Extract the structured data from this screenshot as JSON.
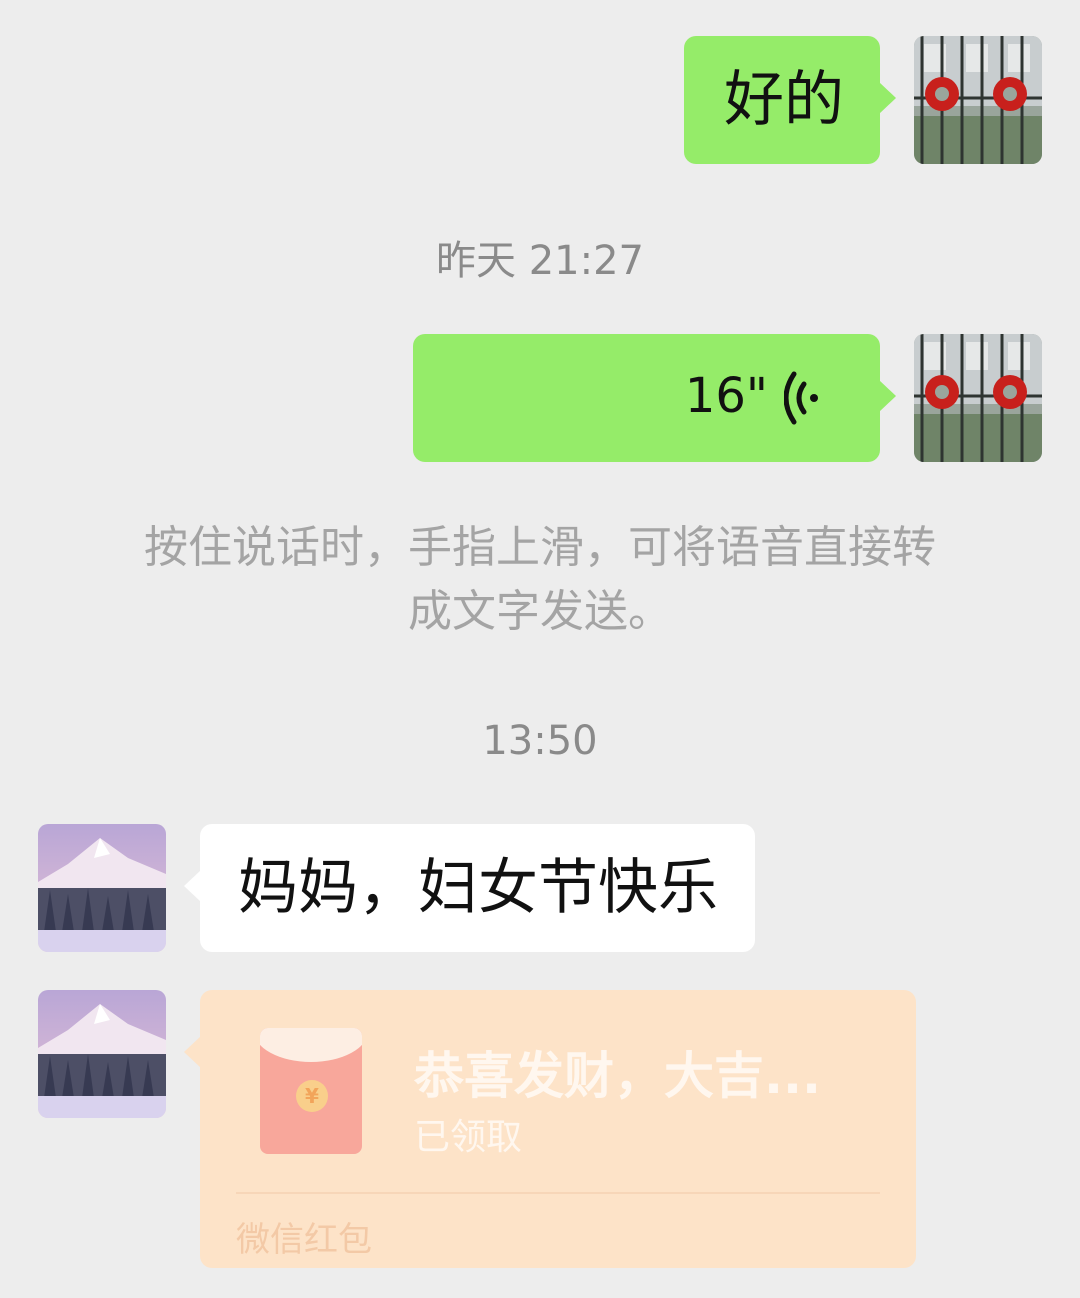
{
  "messages": {
    "msg1": {
      "text": "好的"
    },
    "voice": {
      "duration": "16\""
    },
    "msg3": {
      "text": "妈妈，妇女节快乐"
    },
    "red_packet": {
      "title": "恭喜发财，大吉...",
      "status": "已领取",
      "footer": "微信红包",
      "coin_symbol": "¥"
    }
  },
  "timestamps": {
    "t1": "昨天 21:27",
    "t2": "13:50"
  },
  "tip": {
    "line1": "按住说话时，手指上滑，可将语音直接转",
    "line2": "成文字发送。"
  },
  "colors": {
    "background": "#ededed",
    "outgoing_bubble": "#95ec69",
    "incoming_bubble": "#ffffff",
    "red_packet": "#fde3c8"
  }
}
